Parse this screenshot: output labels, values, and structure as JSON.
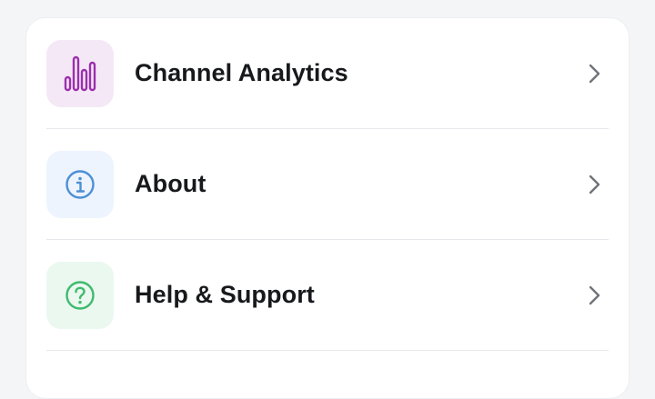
{
  "menu": {
    "items": [
      {
        "label": "Channel Analytics",
        "icon": "bar-chart-icon",
        "accent": "#9b2fae",
        "icon_bg": "#f5e8f6"
      },
      {
        "label": "About",
        "icon": "info-icon",
        "accent": "#4d8fd6",
        "icon_bg": "#edf4fd"
      },
      {
        "label": "Help & Support",
        "icon": "help-icon",
        "accent": "#3fba6e",
        "icon_bg": "#ebf8ef"
      }
    ],
    "chevron_color": "#6f747c"
  }
}
